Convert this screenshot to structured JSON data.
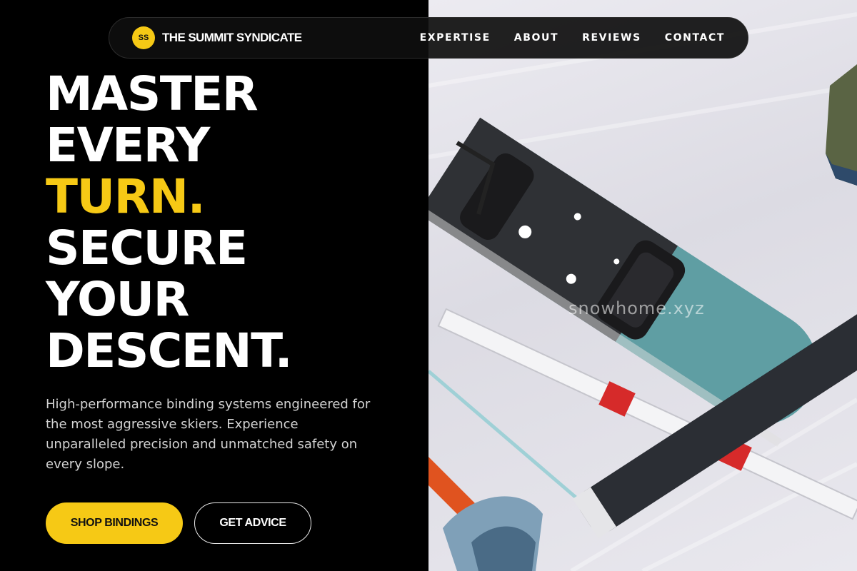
{
  "brand": {
    "initials": "SS",
    "name": "THE SUMMIT SYNDICATE"
  },
  "nav": {
    "links": [
      "EXPERTISE",
      "ABOUT",
      "REVIEWS",
      "CONTACT"
    ]
  },
  "hero": {
    "title_lines": [
      "MASTER",
      "EVERY",
      "TURN.",
      "SECURE",
      "YOUR",
      "DESCENT."
    ],
    "highlight_line": "TURN.",
    "description": "High-performance binding systems engineered for the most aggressive skiers. Experience unparalleled precision and unmatched safety on every slope.",
    "primary_cta": "SHOP BINDINGS",
    "secondary_cta": "GET ADVICE"
  },
  "photo": {
    "watermark": "snowhome.xyz"
  },
  "colors": {
    "accent": "#f6c915",
    "background": "#000000",
    "text": "#ffffff",
    "muted_text": "#d3d3d3"
  },
  "icons": [
    "logo-badge"
  ]
}
